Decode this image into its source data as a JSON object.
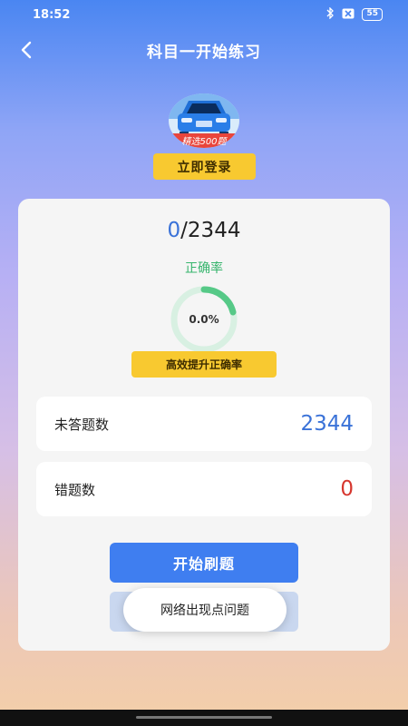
{
  "status_bar": {
    "time": "18:52",
    "battery": "55"
  },
  "nav": {
    "title": "科目一开始练习"
  },
  "avatar": {
    "badge_text": "精选500题"
  },
  "login_button": "立即登录",
  "stats": {
    "done": "0",
    "separator": "/",
    "total": "2344",
    "accuracy_label": "正确率",
    "accuracy_value": "0.0%",
    "improve_button": "高效提升正确率",
    "unanswered_label": "未答题数",
    "unanswered_value": "2344",
    "wrong_label": "错题数",
    "wrong_value": "0"
  },
  "start_button": "开始刷题",
  "toast": "网络出现点问题",
  "colors": {
    "primary": "#3f7ef0",
    "accent_yellow": "#f8c930",
    "success": "#37b56d",
    "danger": "#d6362e"
  }
}
